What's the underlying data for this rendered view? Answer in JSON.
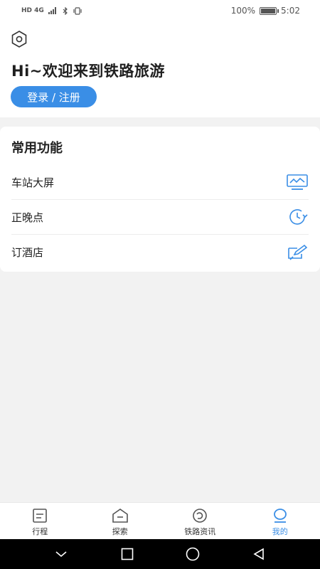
{
  "status_bar": {
    "left_icons": "HD 4G",
    "battery_percent": "100%",
    "battery_level": 1.0,
    "time": "5:02"
  },
  "header": {
    "settings_icon": "hexagon-gear-icon",
    "greeting": "Hi~欢迎来到铁路旅游",
    "login_label": "登录 / 注册"
  },
  "functions": {
    "title": "常用功能",
    "items": [
      {
        "label": "车站大屏",
        "icon": "station-screen-icon"
      },
      {
        "label": "正晚点",
        "icon": "clock-refresh-icon"
      },
      {
        "label": "订酒店",
        "icon": "edit-pen-icon"
      }
    ]
  },
  "bottom_nav": {
    "items": [
      {
        "label": "行程",
        "icon": "itinerary-icon",
        "active": false
      },
      {
        "label": "探索",
        "icon": "explore-icon",
        "active": false
      },
      {
        "label": "铁路资讯",
        "icon": "news-icon",
        "active": false
      },
      {
        "label": "我的",
        "icon": "profile-icon",
        "active": true
      }
    ]
  },
  "colors": {
    "accent": "#3a8ee6",
    "background": "#f2f2f2",
    "card": "#ffffff"
  }
}
